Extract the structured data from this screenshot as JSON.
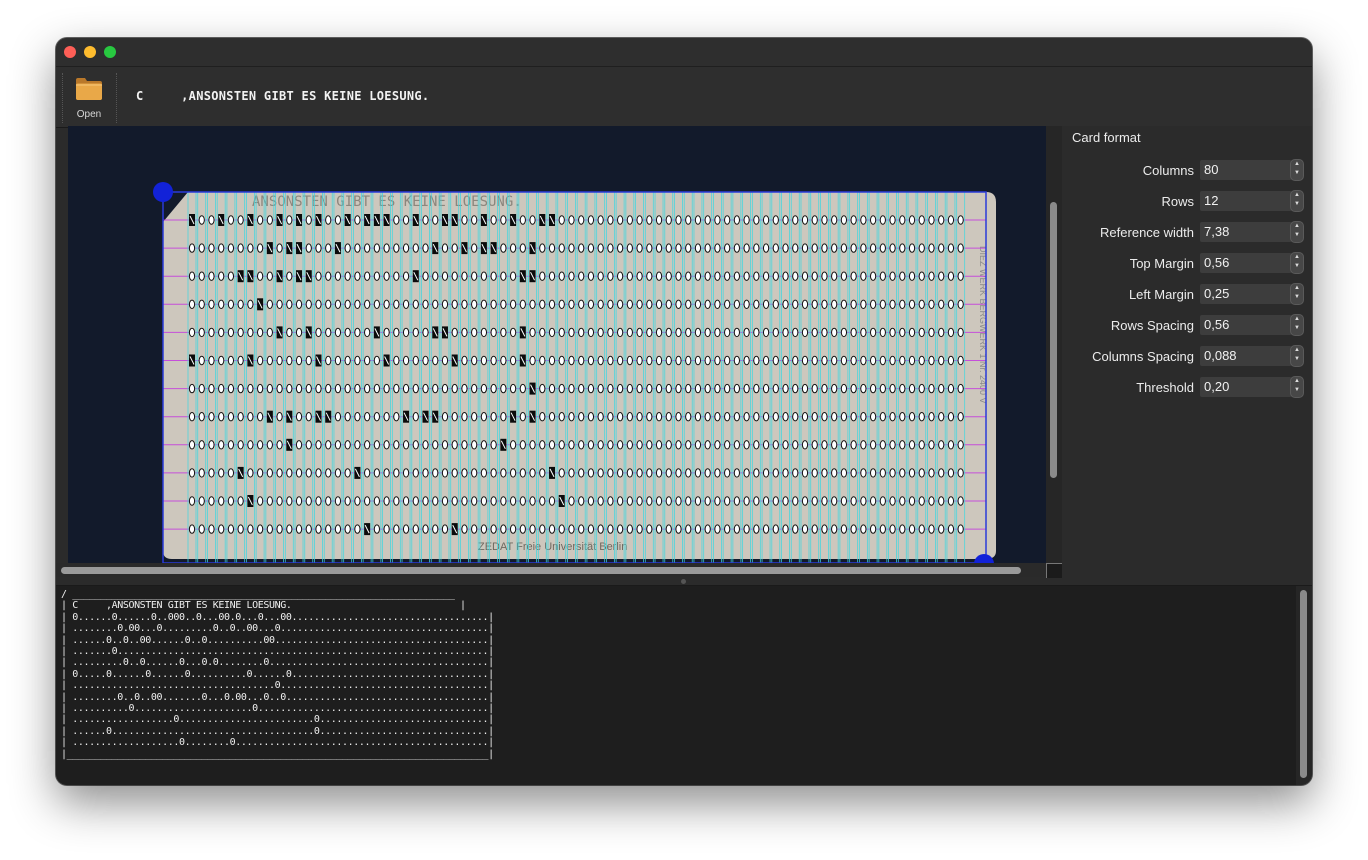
{
  "window": {
    "title_controls": [
      "close",
      "minimize",
      "maximize"
    ]
  },
  "toolbar": {
    "open_label": "Open",
    "card_text": "C     ,ANSONSTEN GIBT ES KEINE LOESUNG."
  },
  "scan": {
    "header_text": "ANSONSTEN GIBT ES KEINE LOESUNG.",
    "footer_text": "ZEDAT Freie Universität Berlin",
    "side_text": "DIEZ WERK BERGWERK 1 Nr. 2400 V",
    "columns": 80,
    "rows": 12,
    "punches": [
      [
        0,
        3,
        6,
        9,
        11,
        13,
        16,
        18,
        19,
        20,
        23,
        26,
        27,
        30,
        33,
        36,
        37
      ],
      [
        8,
        10,
        11,
        15,
        25,
        28,
        30,
        31,
        35
      ],
      [
        5,
        6,
        9,
        11,
        12,
        23,
        34,
        35
      ],
      [
        7
      ],
      [
        9,
        12,
        19,
        25,
        26,
        34
      ],
      [
        0,
        6,
        13,
        20,
        27,
        34
      ],
      [
        35
      ],
      [
        8,
        10,
        13,
        14,
        22,
        24,
        25,
        33,
        35
      ],
      [
        10,
        32
      ],
      [
        5,
        17,
        37
      ],
      [
        6,
        38
      ],
      [
        18,
        27
      ]
    ],
    "colors": {
      "background": "#121a2b",
      "card": "#cdc7bd",
      "grid_columns": "#3fd7e0",
      "grid_rows": "#c43be0",
      "frame": "#2a3bd9",
      "handle": "#1222d8"
    }
  },
  "side_panel": {
    "title": "Card format",
    "fields": [
      {
        "label": "Columns",
        "value": "80"
      },
      {
        "label": "Rows",
        "value": "12"
      },
      {
        "label": "Reference width",
        "value": "7,38"
      },
      {
        "label": "Top Margin",
        "value": "0,56"
      },
      {
        "label": "Left Margin",
        "value": "0,25"
      },
      {
        "label": "Rows Spacing",
        "value": "0,56"
      },
      {
        "label": "Columns Spacing",
        "value": "0,088"
      },
      {
        "label": "Threshold",
        "value": "0,20"
      }
    ]
  },
  "output": {
    "text": "/ ____________________________________________________________________\n| C     ,ANSONSTEN GIBT ES KEINE LOESUNG.                              |\n| 0......0......0..000..0...00.0...0...00...................................|\n| ........0.00...0.........0..0..00...0.....................................|\n| ......0..0..00......0..0..........00......................................|\n| .......0..................................................................|\n| .........0..0......0...0.0........0.......................................|\n| 0.....0......0......0..........0......0...................................|\n| ....................................0.....................................|\n| ........0..0..00.......0...0.00...0..0....................................|\n| ..........0.....................0.........................................|\n| ..................0........................0..............................|\n| ......0....................................0..............................|\n| ...................0........0.............................................|\n|___________________________________________________________________________|"
  }
}
